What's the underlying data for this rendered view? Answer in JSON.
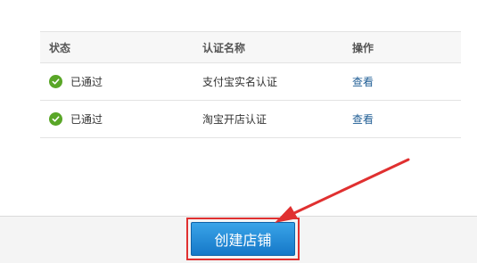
{
  "table": {
    "headers": {
      "status": "状态",
      "name": "认证名称",
      "action": "操作"
    },
    "rows": [
      {
        "status": "已通过",
        "name": "支付宝实名认证",
        "action": "查看"
      },
      {
        "status": "已通过",
        "name": "淘宝开店认证",
        "action": "查看"
      }
    ]
  },
  "footer": {
    "create_store_label": "创建店铺"
  },
  "colors": {
    "check": "#59a627",
    "link": "#1f5d94",
    "button": "#1678c8",
    "highlight": "#e03030"
  },
  "icons": {
    "status": "check-circle-icon",
    "annotation": "red-arrow"
  }
}
